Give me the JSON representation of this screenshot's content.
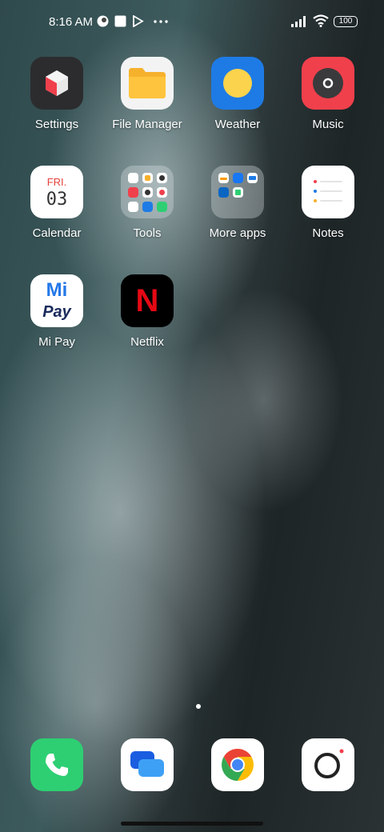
{
  "status_bar": {
    "time": "8:16 AM",
    "battery": "100",
    "icons": [
      "app-notification-icon",
      "square-notification-icon",
      "play-store-icon",
      "more-dots-icon",
      "signal-icon",
      "wifi-icon",
      "battery-icon"
    ]
  },
  "apps": [
    {
      "label": "Settings",
      "icon": "settings-icon"
    },
    {
      "label": "File Manager",
      "icon": "folder-icon"
    },
    {
      "label": "Weather",
      "icon": "weather-icon"
    },
    {
      "label": "Music",
      "icon": "music-icon"
    },
    {
      "label": "Calendar",
      "icon": "calendar-icon",
      "day": "FRI.",
      "date": "03"
    },
    {
      "label": "Tools",
      "icon": "tools-folder-icon"
    },
    {
      "label": "More apps",
      "icon": "more-apps-folder-icon"
    },
    {
      "label": "Notes",
      "icon": "notes-icon"
    },
    {
      "label": "Mi Pay",
      "icon": "mi-pay-icon",
      "line1": "Mi",
      "line2": "Pay"
    },
    {
      "label": "Netflix",
      "icon": "netflix-icon",
      "glyph": "N"
    }
  ],
  "dock": [
    {
      "icon": "phone-icon"
    },
    {
      "icon": "messages-icon"
    },
    {
      "icon": "chrome-icon"
    },
    {
      "icon": "camera-icon"
    }
  ],
  "pages": {
    "count": 1,
    "current": 1
  },
  "colors": {
    "weather_bg": "#1e7be6",
    "music_bg": "#f0404c",
    "phone_bg": "#2ecf73",
    "netflix_red": "#e50914"
  }
}
